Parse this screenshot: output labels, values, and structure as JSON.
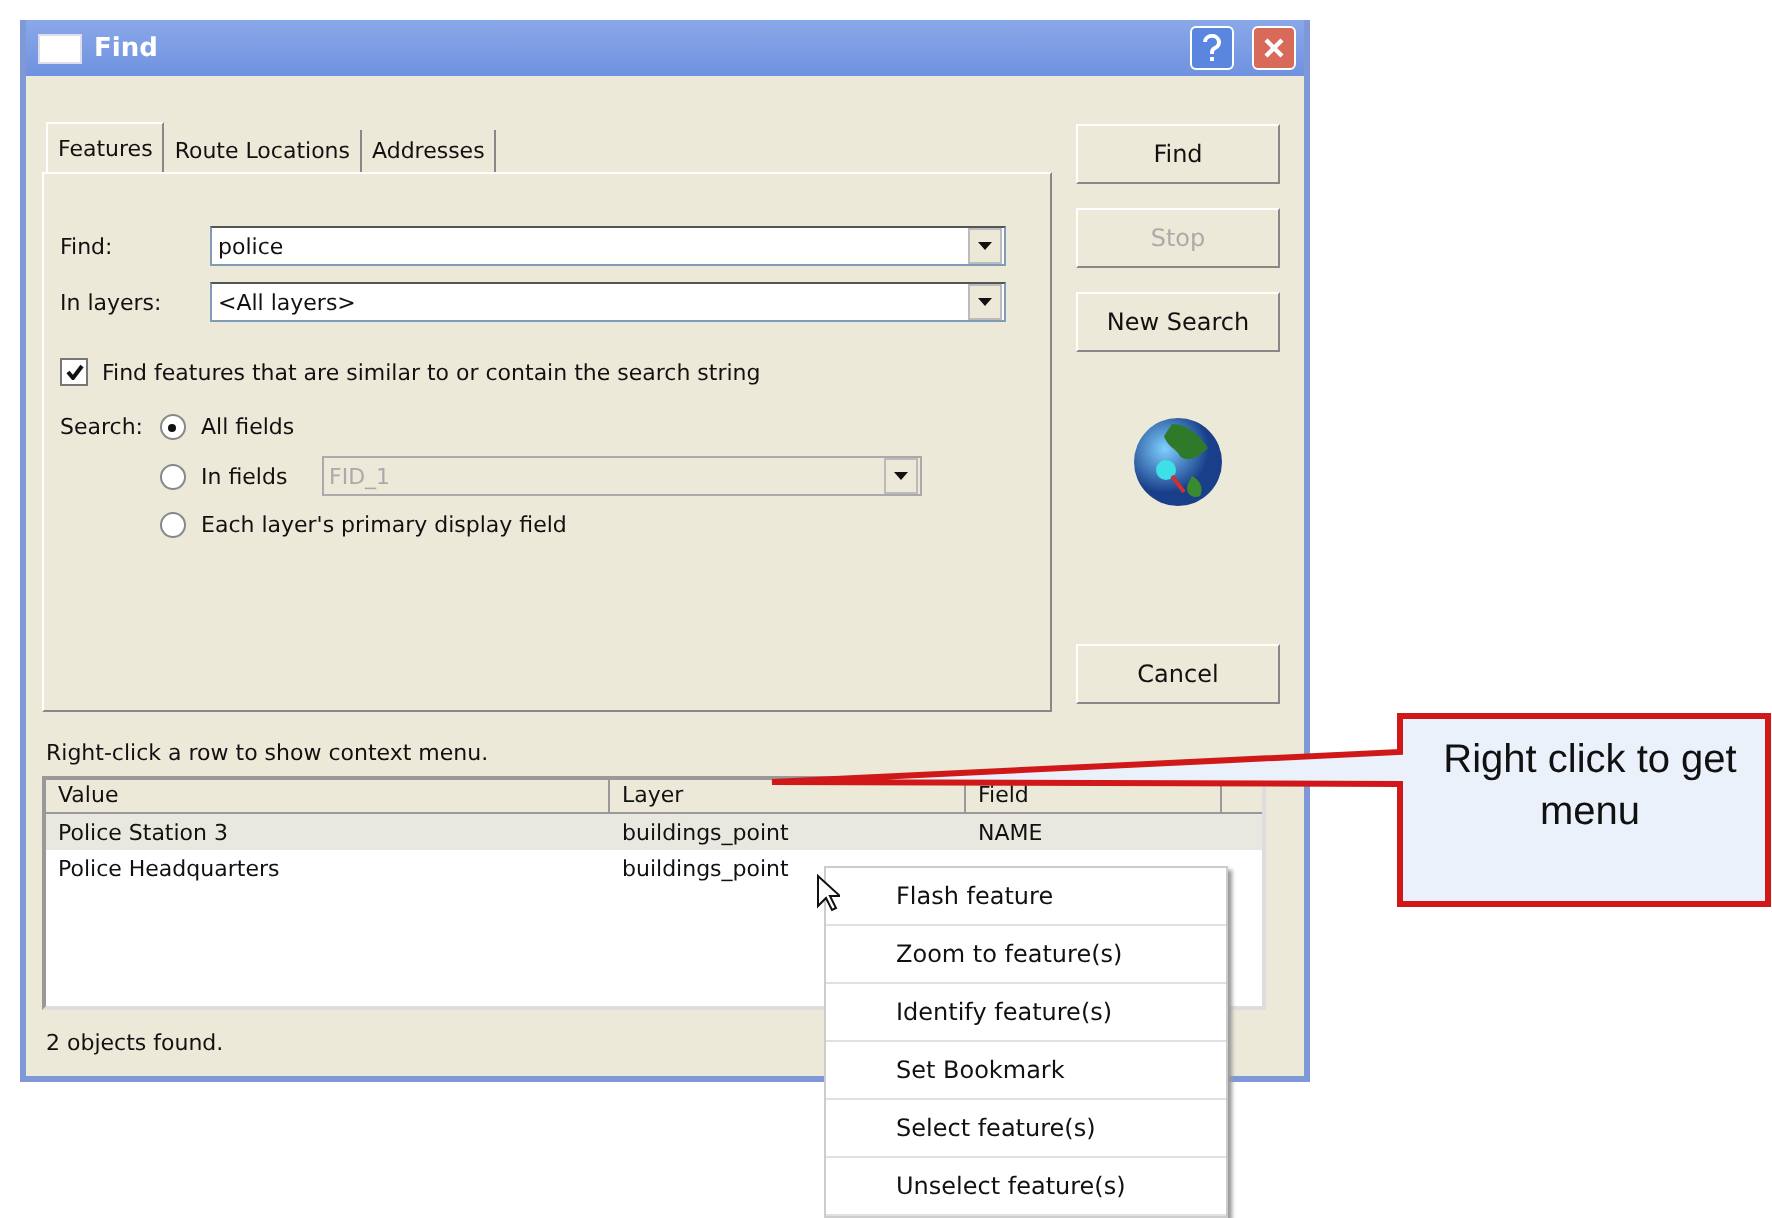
{
  "window": {
    "title": "Find"
  },
  "tabs": [
    {
      "label": "Features",
      "selected": true
    },
    {
      "label": "Route Locations",
      "selected": false
    },
    {
      "label": "Addresses",
      "selected": false
    }
  ],
  "find_field": {
    "label": "Find:",
    "value": "police"
  },
  "layers_field": {
    "label": "In layers:",
    "value": "<All layers>"
  },
  "similar_checkbox": {
    "label": "Find features that are similar to or contain the search string",
    "checked": true
  },
  "search": {
    "label": "Search:",
    "options": [
      {
        "label": "All fields",
        "selected": true
      },
      {
        "label": "In fields",
        "selected": false,
        "field": {
          "value": "FID_1",
          "disabled": true
        }
      },
      {
        "label": "Each layer's primary display field",
        "selected": false
      }
    ]
  },
  "buttons": [
    {
      "label": "Find",
      "disabled": false
    },
    {
      "label": "Stop",
      "disabled": true
    },
    {
      "label": "New Search",
      "disabled": false
    },
    {
      "label": "Cancel",
      "disabled": false
    }
  ],
  "results": {
    "hint": "Right-click a row to show context menu.",
    "columns": [
      "Value",
      "Layer",
      "Field"
    ],
    "rows": [
      {
        "cells": [
          "Police Station 3",
          "buildings_point",
          "NAME"
        ],
        "selected": true
      },
      {
        "cells": [
          "Police Headquarters",
          "buildings_point"
        ],
        "selected": false
      }
    ]
  },
  "status": "2 objects found.",
  "context_menu": [
    "Flash feature",
    "Zoom to feature(s)",
    "Identify feature(s)",
    "Set Bookmark",
    "Select feature(s)",
    "Unselect feature(s)"
  ],
  "callout": {
    "text": "Right click to get menu"
  }
}
